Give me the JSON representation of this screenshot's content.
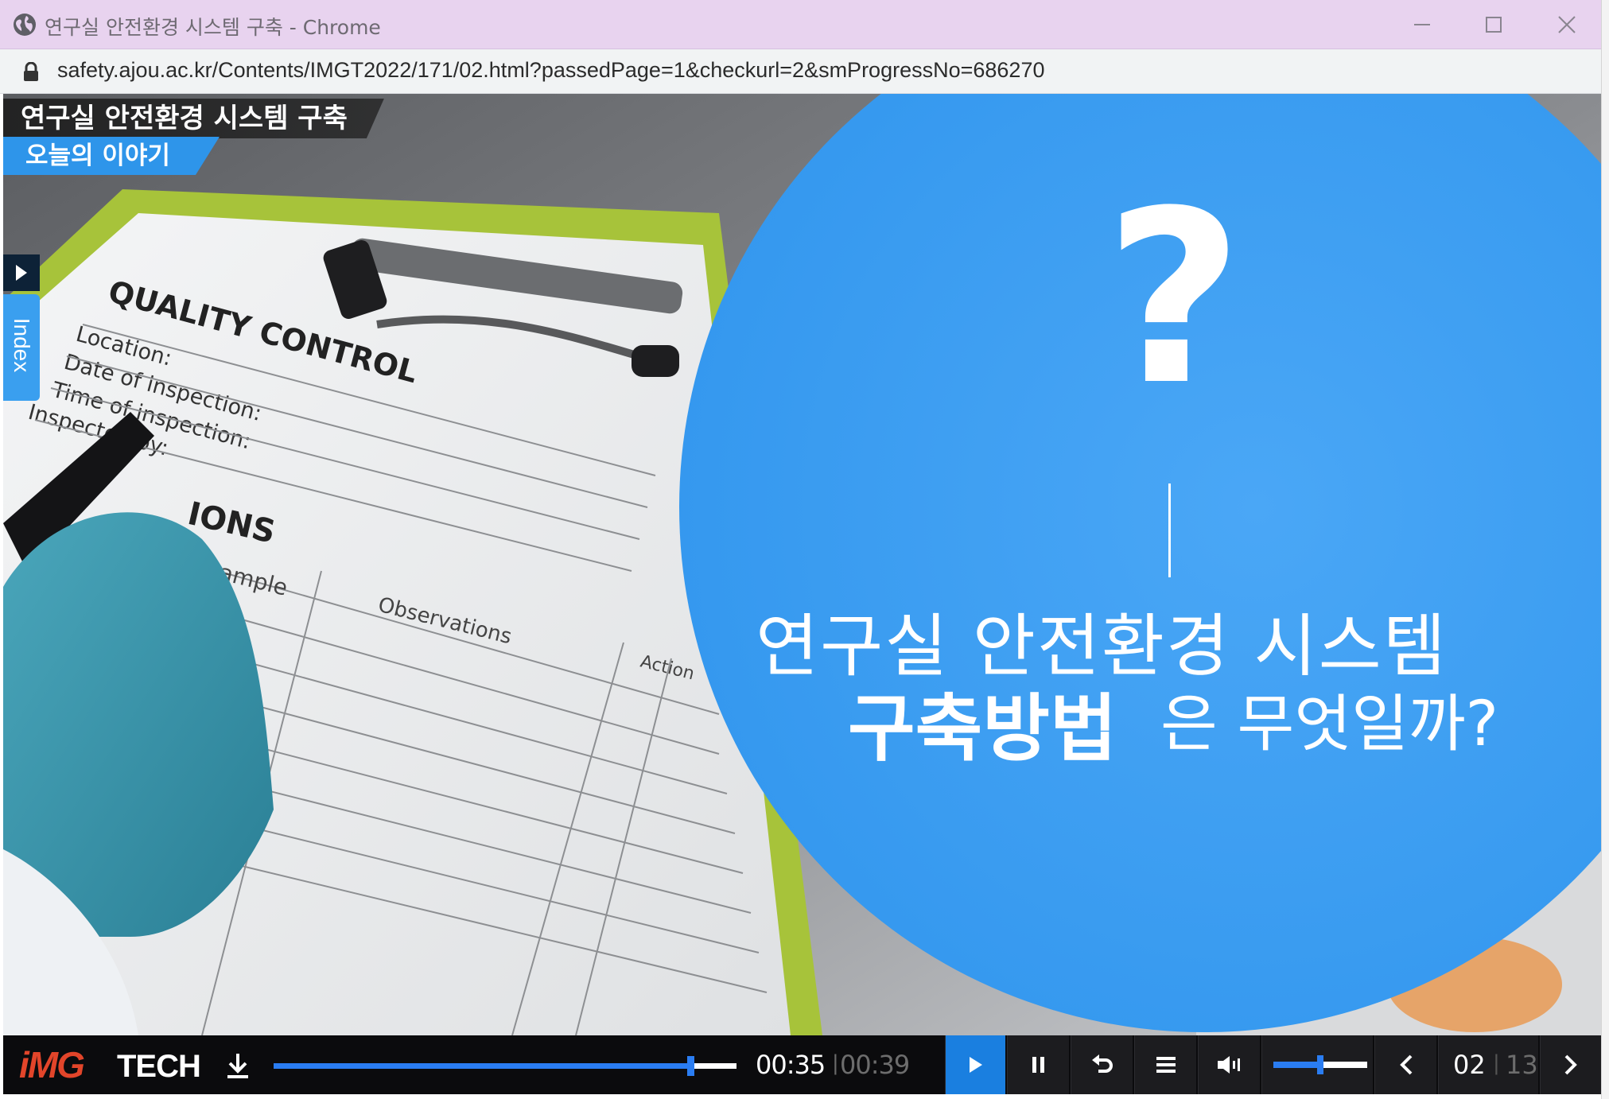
{
  "window": {
    "title": "연구실 안전환경 시스템 구축 - Chrome",
    "url": "safety.ajou.ac.kr/Contents/IMGT2022/171/02.html?passedPage=1&checkurl=2&smProgressNo=686270"
  },
  "lesson": {
    "title": "연구실 안전환경 시스템 구축",
    "subtitle": "오늘의 이야기"
  },
  "index_tab": {
    "label": "Index"
  },
  "slide": {
    "question_mark": "?",
    "line1": "연구실 안전환경 시스템",
    "line2_bold": "구축방법",
    "line2_rest": "은 무엇일까?",
    "photo_text": {
      "heading": "QUALITY CONTROL",
      "fields": [
        "Location:",
        "Date of inspection:",
        "Time of inspection:",
        "Inspected by:"
      ],
      "section": "IONS",
      "col1": "ample",
      "col2": "Observations",
      "col3": "Action"
    }
  },
  "player": {
    "brand_img": "iMG",
    "brand_tech": "TECH",
    "current_time": "00:35",
    "total_time": "00:39",
    "separator": "|",
    "progress": 0.9,
    "volume": 0.5,
    "current_page": "02",
    "total_pages": "13"
  },
  "colors": {
    "accent_blue": "#2e95ea",
    "circle_blue": "#3d9df2",
    "control_bg": "#0b0b0d",
    "brand_red": "#e2452a"
  }
}
